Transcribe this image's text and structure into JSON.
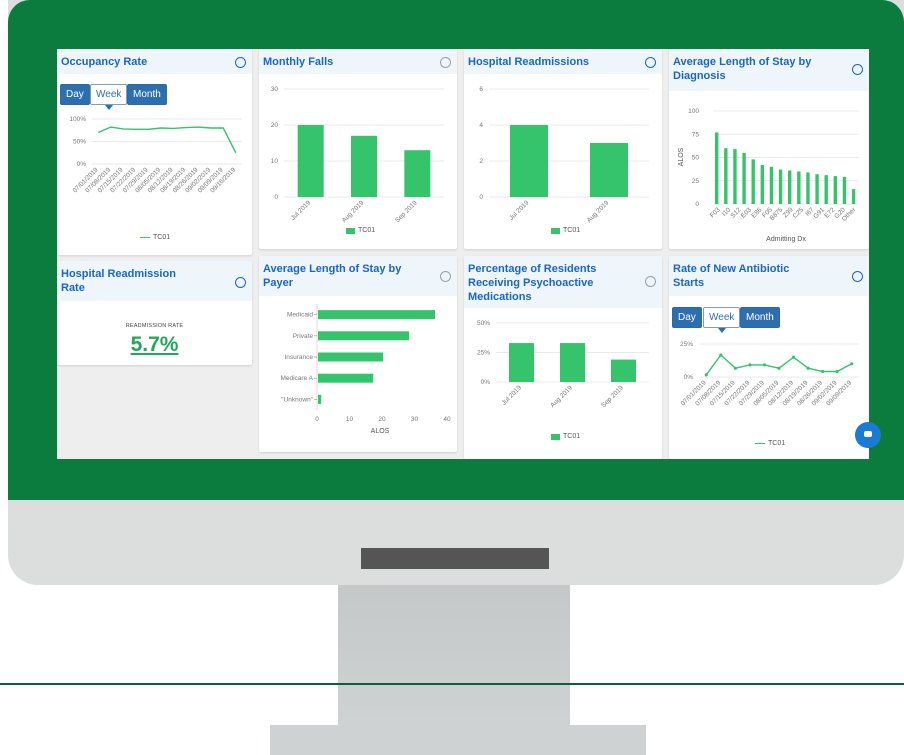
{
  "colors": {
    "frame": "#0b7b3e",
    "accent": "#1a66c4",
    "bar": "#35c46c",
    "button": "#2d6fae"
  },
  "cards": {
    "occupancy": {
      "title": "Occupancy Rate",
      "toggles": [
        "Day",
        "Week",
        "Month"
      ],
      "active_toggle": "Week",
      "legend": "TC01"
    },
    "falls": {
      "title": "Monthly Falls",
      "legend": "TC01"
    },
    "readmissions": {
      "title": "Hospital Readmissions",
      "legend": "TC01"
    },
    "alos_dx": {
      "title": "Average Length of Stay by Diagnosis"
    },
    "readmission_rate": {
      "title": "Hospital Readmission Rate",
      "label": "READMISSION RATE",
      "value": "5.7%"
    },
    "alos_payer": {
      "title": "Average Length of Stay by Payer"
    },
    "psychoactive": {
      "title": "Percentage of Residents Receiving Psychoactive Medications",
      "legend": "TC01"
    },
    "antibiotic": {
      "title": "Rate of New Antibiotic Starts",
      "toggles": [
        "Day",
        "Week",
        "Month"
      ],
      "active_toggle": "Week",
      "legend": "TC01"
    }
  },
  "chart_data": [
    {
      "id": "occupancy",
      "type": "line",
      "x": [
        "07/01/2019",
        "07/08/2019",
        "07/15/2019",
        "07/22/2019",
        "07/29/2019",
        "08/05/2019",
        "08/12/2019",
        "08/19/2019",
        "08/26/2019",
        "09/02/2019",
        "09/09/2019",
        "09/16/2019"
      ],
      "series": [
        {
          "name": "TC01",
          "values": [
            70,
            82,
            78,
            77,
            77,
            80,
            79,
            81,
            82,
            80,
            80,
            25
          ]
        }
      ],
      "yticks": [
        "0%",
        "50%",
        "100%"
      ],
      "ylim": [
        0,
        100
      ]
    },
    {
      "id": "falls",
      "type": "bar",
      "categories": [
        "Jul 2019",
        "Aug 2019",
        "Sep 2019"
      ],
      "series": [
        {
          "name": "TC01",
          "values": [
            20,
            17,
            13
          ]
        }
      ],
      "yticks": [
        "0",
        "10",
        "20",
        "30"
      ],
      "ylim": [
        0,
        30
      ]
    },
    {
      "id": "readmissions",
      "type": "bar",
      "categories": [
        "Jul 2019",
        "Aug 2019"
      ],
      "series": [
        {
          "name": "TC01",
          "values": [
            4,
            3
          ]
        }
      ],
      "yticks": [
        "0",
        "2",
        "4",
        "6"
      ],
      "ylim": [
        0,
        6
      ]
    },
    {
      "id": "alos_dx",
      "type": "bar",
      "categories": [
        "F03",
        "I10",
        "S12",
        "E03",
        "E86",
        "F05",
        "B875",
        "Z99",
        "C25",
        "I67",
        "G91",
        "E72",
        "G20",
        "Other"
      ],
      "values": [
        77,
        60,
        59,
        55,
        48,
        42,
        40,
        37,
        36,
        35,
        34,
        32,
        31,
        30,
        29,
        16
      ],
      "xlabel": "Admitting Dx",
      "ylabel": "ALOS",
      "yticks": [
        "0",
        "25",
        "50",
        "75",
        "100"
      ],
      "ylim": [
        0,
        100
      ]
    },
    {
      "id": "alos_payer",
      "type": "bar",
      "orientation": "horizontal",
      "categories": [
        "Medicaid",
        "Private",
        "Insurance",
        "Medicare A",
        "\"Unknown\""
      ],
      "values": [
        36,
        28,
        20,
        17,
        1
      ],
      "xlabel": "ALOS",
      "xticks": [
        "0",
        "10",
        "20",
        "30",
        "40"
      ],
      "xlim": [
        0,
        40
      ]
    },
    {
      "id": "psychoactive",
      "type": "bar",
      "categories": [
        "Jul 2019",
        "Aug 2019",
        "Sep 2019"
      ],
      "series": [
        {
          "name": "TC01",
          "values": [
            33,
            33,
            19
          ]
        }
      ],
      "yticks": [
        "0%",
        "25%",
        "50%"
      ],
      "ylim": [
        0,
        50
      ]
    },
    {
      "id": "antibiotic",
      "type": "line",
      "x": [
        "07/01/2019",
        "07/08/2019",
        "07/15/2019",
        "07/22/2019",
        "07/29/2019",
        "08/05/2019",
        "08/12/2019",
        "08/19/2019",
        "08/26/2019",
        "09/02/2019",
        "09/09/2019"
      ],
      "series": [
        {
          "name": "TC01",
          "values": [
            2,
            20,
            8,
            11,
            11,
            8,
            18,
            8,
            5,
            5,
            12
          ]
        }
      ],
      "yticks": [
        "0%",
        "25%"
      ],
      "ylim": [
        0,
        30
      ]
    }
  ]
}
